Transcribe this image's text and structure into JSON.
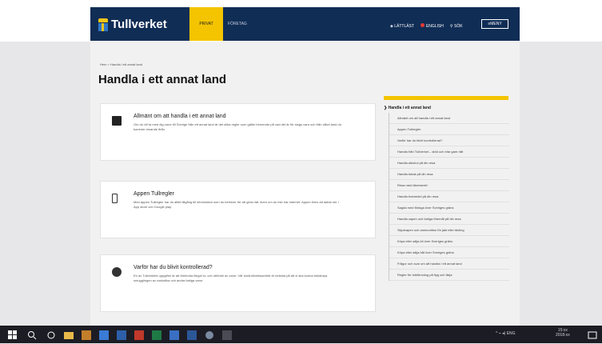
{
  "header": {
    "logo_text": "Tullverket",
    "tab_private": "Privat",
    "tab_company": "Företag",
    "links": {
      "easy_read": "Lättläst",
      "english": "English",
      "search": "Sök",
      "menu": "Meny"
    }
  },
  "breadcrumb": "Hem > Handla i ett annat land",
  "page_title": "Handla i ett annat land",
  "cards": [
    {
      "icon": "briefcase-icon",
      "title": "Allmänt om att handla i ett annat land",
      "text": "Om du vill ta med dig varor till Sverige från ett annat land är det olika regler som gäller beroende på vad det är för slags vara och från vilket land du kommer resande ifrån."
    },
    {
      "icon": "phone-icon",
      "title": "Appen Tullregler",
      "text": "Med appen Tullregler har du alltid tillgång till information som du behöver för att göra rätt, även om du inte har internet. Appen finns att ladda ner i App store och Google play."
    },
    {
      "icon": "question-circle-icon",
      "title": "Varför har du blivit kontrollerad?",
      "text": "En av Tullverkets uppgifter är att förhindra illegal in- och utförsel av varor. Vår kontrollverksamhet är inriktad på att vi ska kunna bekämpa smugglingen av narkotika och andra farliga varor."
    }
  ],
  "sidebar": {
    "current": "Handla i ett annat land",
    "items": [
      "Allmänt om att handla i ett annat land",
      "Appen Tullregler",
      "Varför har du blivit kontrollerad?",
      "Handla från Tullverket – stöd och elar gare rätt",
      "Handla alkohol på din resa",
      "Handla tobak på din resa",
      "Resa med läkemedel",
      "Handla livsmedel på din resa",
      "Sagda med förlaga över Sveriges gräns",
      "Handla vapen och farliga föremål på din resa",
      "Skjutvapen och ammunition för jakt eller tävling",
      "Köpa eller sälja bil över Sveriges gräns",
      "Köpa eller sälja båt över Sveriges gräns",
      "Frågor och svar om att handla i ett annat land",
      "Regler för tolkförsning på flyg och färja"
    ]
  },
  "taskbar": {
    "tray_text": "^ ⌁ ◂) ENG",
    "time": "15:xx",
    "date": "2018-xx"
  }
}
